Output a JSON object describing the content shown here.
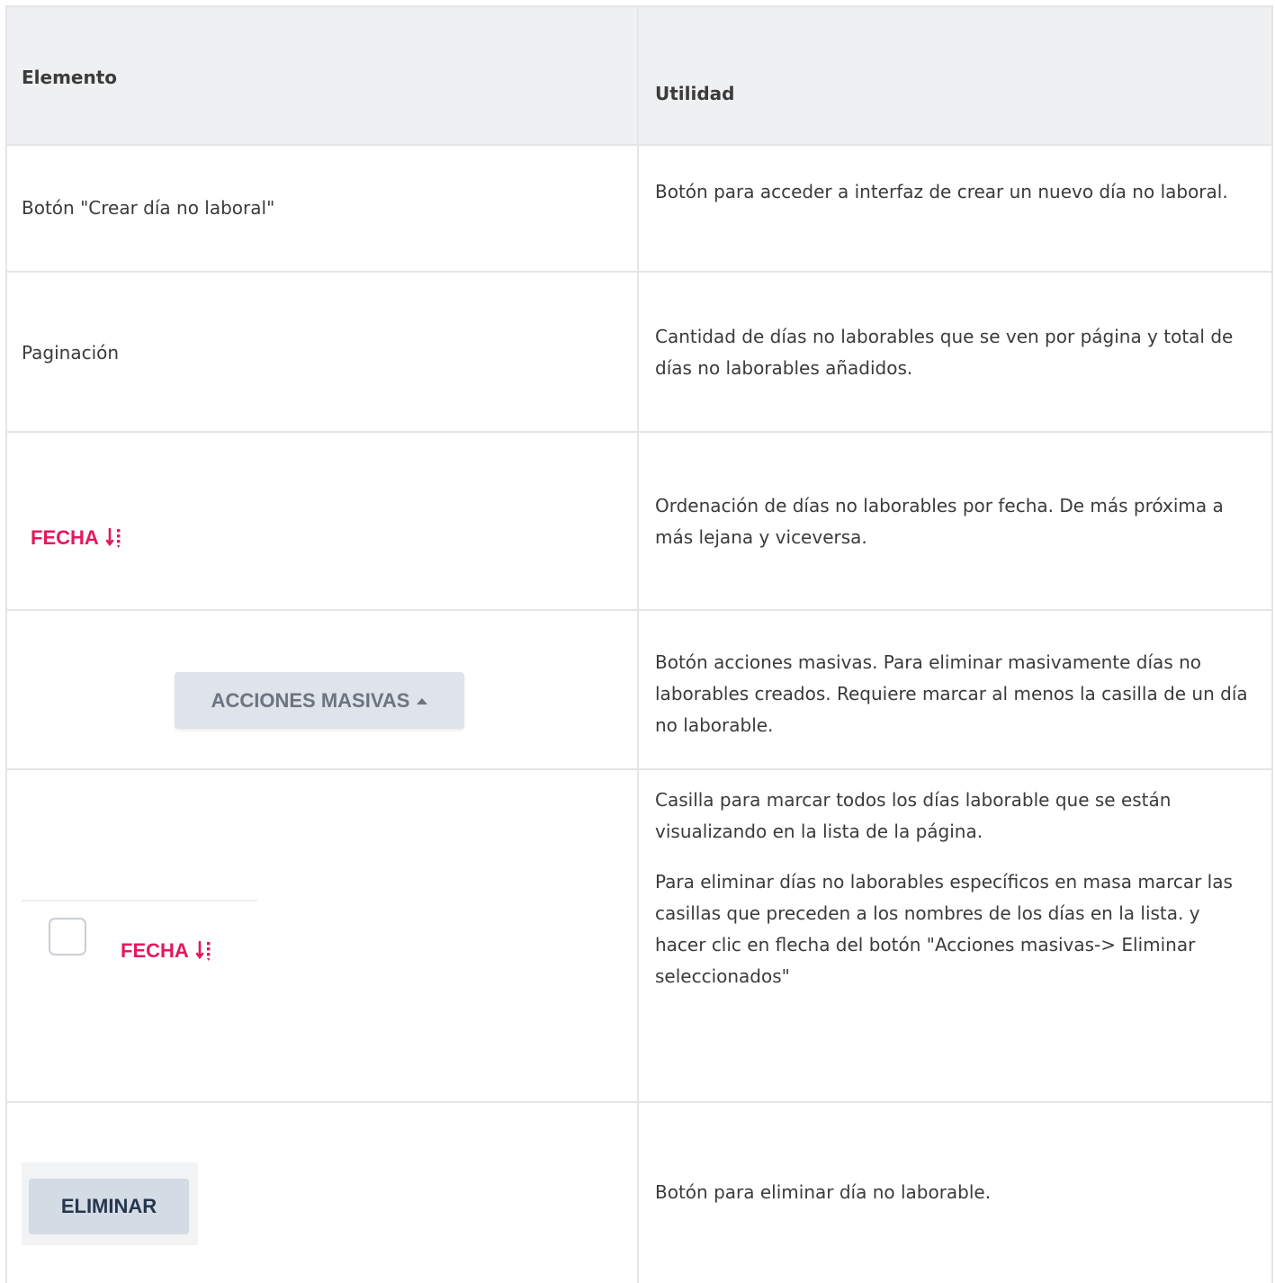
{
  "table": {
    "headers": {
      "element": "Elemento",
      "utility": "Utilidad"
    },
    "rows": [
      {
        "element_text": "Botón \"Crear día no laboral\"",
        "utility": [
          "Botón para acceder a interfaz de crear un nuevo día no laboral."
        ]
      },
      {
        "element_text": "Paginación",
        "utility": [
          "Cantidad de días no laborables que se ven por página y total de días no laborables añadidos."
        ]
      },
      {
        "element_label": "FECHA",
        "element_icon": "sort-date-icon",
        "utility": [
          "Ordenación de días no laborables por fecha. De más próxima a más lejana y viceversa."
        ]
      },
      {
        "element_button": "ACCIONES MASIVAS",
        "element_icon": "caret-up-icon",
        "utility": [
          "Botón acciones masivas. Para eliminar  masivamente días no laborables creados. Requiere marcar al menos la casilla de un día no laborable."
        ]
      },
      {
        "element_label": "FECHA",
        "element_icon": "checkbox-icon",
        "utility": [
          "Casilla para marcar todos los días laborable que se están visualizando en la lista de la página.",
          "Para eliminar días no laborables específicos en masa marcar  las casillas que preceden  a los nombres de los días en la lista. y hacer clic en flecha del botón \"Acciones masivas-> Eliminar seleccionados\""
        ]
      },
      {
        "element_button": "ELIMINAR",
        "utility": [
          "Botón para eliminar día no laborable."
        ]
      }
    ]
  },
  "colors": {
    "border": "#e3e5e7",
    "header_bg": "#eef0f1",
    "text": "#3b3b3b",
    "accent_pink": "#e3185d",
    "masivas_bg": "#dfe3ea",
    "eliminar_bg": "#d3dbe5",
    "eliminar_text": "#26364d"
  }
}
